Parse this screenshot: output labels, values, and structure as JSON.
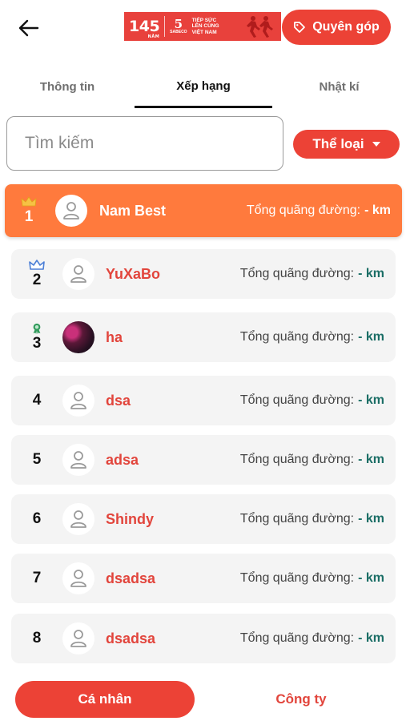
{
  "header": {
    "logo": {
      "number": "145",
      "number_sub": "NĂM",
      "brand_mark": "5",
      "brand_name": "SABECO",
      "slogan": [
        "TIẾP SỨC",
        "LÊN CÙNG",
        "VIỆT NAM"
      ]
    },
    "donate_label": "Quyên góp"
  },
  "tabs": [
    {
      "label": "Thông tin",
      "active": false
    },
    {
      "label": "Xếp hạng",
      "active": true
    },
    {
      "label": "Nhật kí",
      "active": false
    }
  ],
  "search": {
    "placeholder": "Tìm kiếm",
    "value": ""
  },
  "category_label": "Thể loại",
  "leaderboard": [
    {
      "rank": "1",
      "name": "Nam Best",
      "distance_label": "Tổng quãng đường:",
      "distance_value": "- km",
      "medal": "gold-crown",
      "avatar": "default"
    },
    {
      "rank": "2",
      "name": "YuXaBo",
      "distance_label": "Tổng quãng đường:",
      "distance_value": "- km",
      "medal": "blue-crown",
      "avatar": "default"
    },
    {
      "rank": "3",
      "name": "ha",
      "distance_label": "Tổng quãng đường:",
      "distance_value": "- km",
      "medal": "green-medal",
      "avatar": "photo"
    },
    {
      "rank": "4",
      "name": "dsa",
      "distance_label": "Tổng quãng đường:",
      "distance_value": "- km",
      "medal": "",
      "avatar": "default"
    },
    {
      "rank": "5",
      "name": "adsa",
      "distance_label": "Tổng quãng đường:",
      "distance_value": "- km",
      "medal": "",
      "avatar": "default"
    },
    {
      "rank": "6",
      "name": "Shindy",
      "distance_label": "Tổng quãng đường:",
      "distance_value": "- km",
      "medal": "",
      "avatar": "default"
    },
    {
      "rank": "7",
      "name": "dsadsa",
      "distance_label": "Tổng quãng đường:",
      "distance_value": "- km",
      "medal": "",
      "avatar": "default"
    },
    {
      "rank": "8",
      "name": "dsadsa",
      "distance_label": "Tổng quãng đường:",
      "distance_value": "- km",
      "medal": "",
      "avatar": "default"
    }
  ],
  "bottom": {
    "personal_label": "Cá nhân",
    "company_label": "Công ty"
  },
  "colors": {
    "accent": "#ec4236",
    "top_row": "#ff7a3d",
    "distance_value": "#1b6e66",
    "gold": "#f6c244",
    "blue": "#4c7fd6",
    "green": "#2f9a5a"
  }
}
